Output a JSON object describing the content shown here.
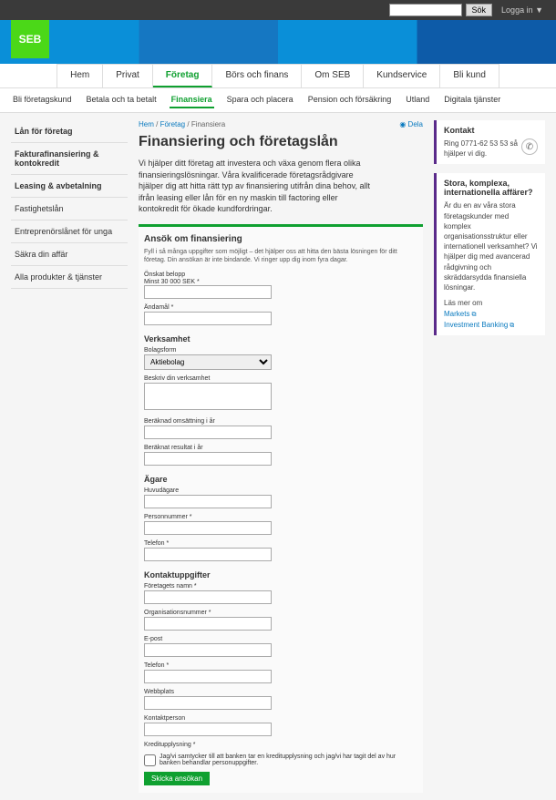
{
  "topbar": {
    "search_btn": "Sök",
    "login": "Logga in ▼",
    "search_placeholder": ""
  },
  "logo": "SEB",
  "nav1": [
    "Hem",
    "Privat",
    "Företag",
    "Börs och finans",
    "Om SEB",
    "Kundservice",
    "Bli kund"
  ],
  "nav1_active": 2,
  "nav2": [
    "Bli företagskund",
    "Betala och ta betalt",
    "Finansiera",
    "Spara och placera",
    "Pension och försäkring",
    "Utland",
    "Digitala tjänster"
  ],
  "nav2_active": 2,
  "crumb": {
    "parts": [
      "Hem",
      "Företag",
      "Finansiera"
    ],
    "share": "Dela"
  },
  "title": "Finansiering och företagslån",
  "intro": "Vi hjälper ditt företag att investera och växa genom flera olika finansieringslösningar. Våra kvalificerade företagsrådgivare hjälper dig att hitta rätt typ av finansiering utifrån dina behov, allt ifrån leasing eller lån för en ny maskin till factoring eller kontokredit för ökade kundfordringar.",
  "sidebar": [
    {
      "label": "Lån för företag",
      "bold": true
    },
    {
      "label": "Fakturafinansiering & kontokredit",
      "bold": true
    },
    {
      "label": "Leasing & avbetalning",
      "bold": true
    },
    {
      "label": "Fastighetslån",
      "bold": false
    },
    {
      "label": "Entreprenörslånet för unga",
      "bold": false
    },
    {
      "label": "Säkra din affär",
      "bold": false
    },
    {
      "label": "Alla produkter & tjänster",
      "bold": false
    }
  ],
  "form": {
    "heading": "Ansök om finansiering",
    "hint": "Fyll i så många uppgifter som möjligt – det hjälper oss att hitta den bästa lösningen för ditt företag. Din ansökan är inte bindande. Vi ringer upp dig inom fyra dagar.",
    "amount_label": "Önskat belopp",
    "amount_hint": "Minst 30 000 SEK *",
    "purpose_label": "Ändamål *",
    "sec_business": "Verksamhet",
    "legal_label": "Bolagsform",
    "legal_value": "Aktiebolag",
    "desc_label": "Beskriv din verksamhet",
    "turnover_label": "Beräknad omsättning i år",
    "result_label": "Beräknat resultat i år",
    "sec_owner": "Ägare",
    "owner_label": "Huvudägare",
    "pnr_label": "Personnummer *",
    "tel1_label": "Telefon *",
    "sec_contact": "Kontaktuppgifter",
    "company_label": "Företagets namn *",
    "orgnr_label": "Organisationsnummer *",
    "email_label": "E-post",
    "tel2_label": "Telefon *",
    "web_label": "Webbplats",
    "contact_label": "Kontaktperson",
    "credit_label": "Kreditupplysning *",
    "credit_text": "Jag/vi samtycker till att banken tar en kreditupplysning och jag/vi har tagit del av hur banken behandlar personuppgifter.",
    "submit": "Skicka ansökan"
  },
  "contact_card": {
    "title": "Kontakt",
    "text": "Ring 0771-62 53 53 så hjälper vi dig."
  },
  "complex_card": {
    "title": "Stora, komplexa, internationella affärer?",
    "text": "Är du en av våra stora företagskunder med komplex organisationsstruktur eller internationell verksamhet? Vi hjälper dig med avancerad rådgivning och skräddarsydda finansiella lösningar.",
    "more": "Läs mer om",
    "link1": "Markets",
    "link2": "Investment Banking"
  }
}
